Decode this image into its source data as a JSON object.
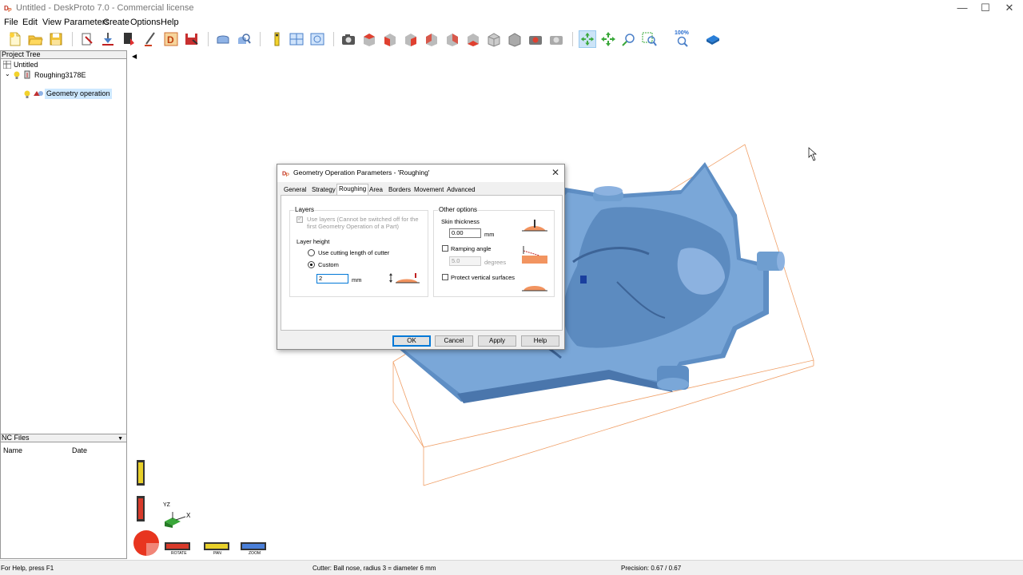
{
  "window": {
    "title": "Untitled - DeskProto 7.0 - Commercial license",
    "minimize_glyph": "—",
    "maximize_glyph": "☐",
    "close_glyph": "✕"
  },
  "menu": [
    "File",
    "Edit",
    "View",
    "Parameters",
    "Create",
    "Options",
    "Help"
  ],
  "toolbar": {
    "zoom_badge": "100%"
  },
  "project_tree": {
    "header": "Project Tree",
    "root": "Untitled",
    "part": "Roughing3178E",
    "operation": "Geometry operation",
    "collapse_arrow": "◀"
  },
  "nc_files": {
    "header": "NC Files",
    "col_name": "Name",
    "col_date": "Date",
    "dropdown_glyph": "▼"
  },
  "view_controls": {
    "rotate": "ROTATE",
    "pan": "PAN",
    "zoom": "ZOOM",
    "axis_yz": "YZ",
    "axis_x": "X"
  },
  "dialog": {
    "title": "Geometry Operation Parameters - 'Roughing'",
    "close_glyph": "✕",
    "tabs": [
      "General",
      "Strategy",
      "Roughing",
      "Area",
      "Borders",
      "Movement",
      "Advanced"
    ],
    "active_tab": "Roughing",
    "layers": {
      "group_label": "Layers",
      "use_layers_label": "Use layers (Cannot be switched off for the first Geometry Operation of a Part)",
      "layer_height_label": "Layer height",
      "option_cutting_length": "Use cutting length of cutter",
      "option_custom": "Custom",
      "custom_value": "2",
      "unit": "mm"
    },
    "other": {
      "group_label": "Other options",
      "skin_label": "Skin thickness",
      "skin_value": "0.00",
      "skin_unit": "mm",
      "ramping_label": "Ramping angle",
      "ramping_value": "5.0",
      "ramping_unit": "degrees",
      "protect_label": "Protect vertical surfaces"
    },
    "buttons": {
      "ok": "OK",
      "cancel": "Cancel",
      "apply": "Apply",
      "help": "Help"
    }
  },
  "status": {
    "help": "For Help, press F1",
    "cutter": "Cutter: Ball nose, radius 3 = diameter 6 mm",
    "precision": "Precision: 0.67 / 0.67"
  },
  "colors": {
    "model_blue": "#6f9ed0",
    "bbox_orange": "#f0a068",
    "selection": "#cde8ff",
    "default_button": "#0078d7"
  }
}
